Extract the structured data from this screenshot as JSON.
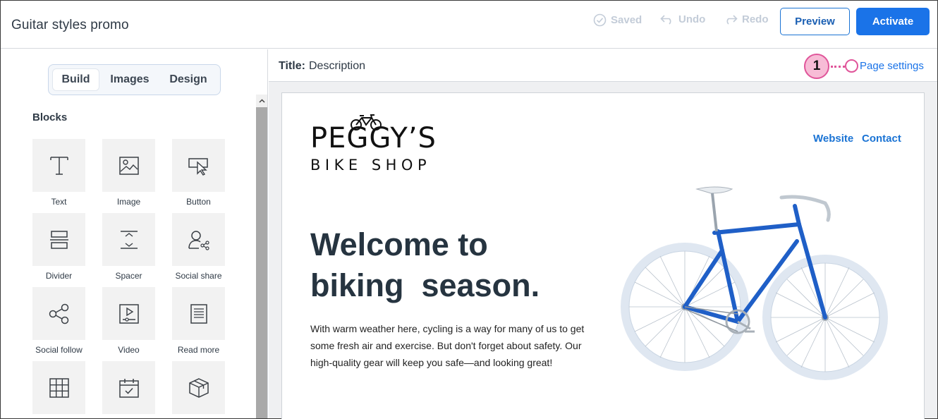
{
  "header": {
    "doc_title": "Guitar styles promo",
    "saved_label": "Saved",
    "undo_label": "Undo",
    "redo_label": "Redo",
    "preview_label": "Preview",
    "activate_label": "Activate"
  },
  "sidebar": {
    "tabs": [
      {
        "label": "Build",
        "active": true
      },
      {
        "label": "Images",
        "active": false
      },
      {
        "label": "Design",
        "active": false
      }
    ],
    "blocks_heading": "Blocks",
    "blocks": [
      {
        "label": "Text",
        "icon": "text-icon"
      },
      {
        "label": "Image",
        "icon": "image-icon"
      },
      {
        "label": "Button",
        "icon": "button-icon"
      },
      {
        "label": "Divider",
        "icon": "divider-icon"
      },
      {
        "label": "Spacer",
        "icon": "spacer-icon"
      },
      {
        "label": "Social share",
        "icon": "social-share-icon"
      },
      {
        "label": "Social follow",
        "icon": "social-follow-icon"
      },
      {
        "label": "Video",
        "icon": "video-icon"
      },
      {
        "label": "Read more",
        "icon": "read-more-icon"
      },
      {
        "label": "",
        "icon": "table-icon"
      },
      {
        "label": "",
        "icon": "calendar-icon"
      },
      {
        "label": "",
        "icon": "product-icon"
      }
    ]
  },
  "canvas": {
    "title_label": "Title:",
    "title_value": "Description",
    "callout_number": "1",
    "page_settings_label": "Page settings"
  },
  "email": {
    "logo_top": "PEGGY’S",
    "logo_bottom": "BIKE SHOP",
    "nav_links": [
      "Website",
      "Contact"
    ],
    "headline_line1": "Welcome to",
    "headline_line2": "biking  season.",
    "body_copy": "With warm weather here, cycling is a way for many of us to get some fresh air and exercise. But don't forget about safety. Our high-quality gear will keep you safe—and looking great!"
  },
  "colors": {
    "accent": "#1a73e8",
    "callout": "#e0559a",
    "bike_frame": "#1f5fc7"
  }
}
